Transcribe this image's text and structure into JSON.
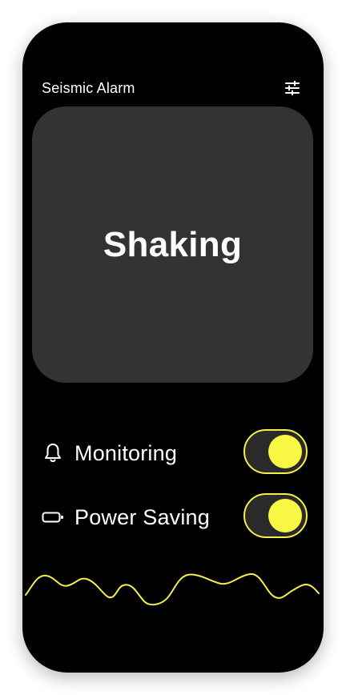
{
  "app": {
    "title": "Seismic Alarm",
    "settings_icon": "sliders-icon"
  },
  "status": {
    "text": "Shaking"
  },
  "settings": [
    {
      "key": "monitoring",
      "label": "Monitoring",
      "icon": "bell-icon",
      "enabled": true
    },
    {
      "key": "power_saving",
      "label": "Power Saving",
      "icon": "battery-icon",
      "enabled": true
    }
  ],
  "theme": {
    "accent": "#f8f845",
    "background": "#000000",
    "card": "#333333",
    "text": "#ffffff"
  },
  "waveform": {
    "icon": "seismic-waveform",
    "color": "#f5ef4c"
  }
}
